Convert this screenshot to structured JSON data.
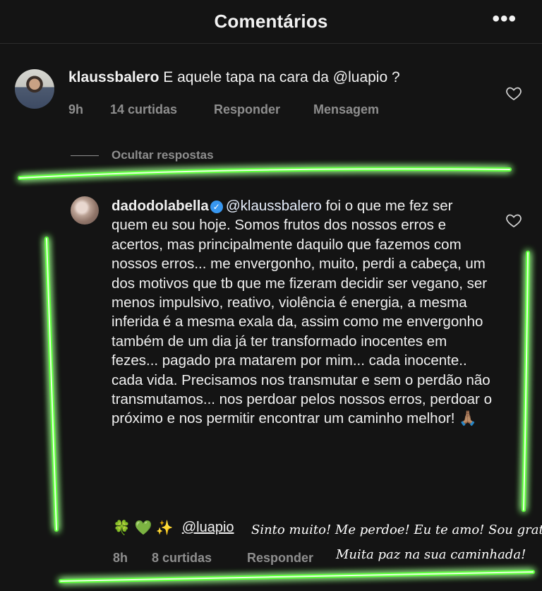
{
  "header": {
    "title": "Comentários",
    "more_icon": "more-horizontal-icon",
    "more_label": "•••"
  },
  "comment": {
    "username": "klaussbalero",
    "text": "E aquele tapa na cara da",
    "mention": "@luapio",
    "text_end": " ?",
    "time": "9h",
    "likes": "14 curtidas",
    "reply": "Responder",
    "message": "Mensagem"
  },
  "hide_replies": "Ocultar respostas",
  "reply": {
    "username": "dadodolabella",
    "mention": "@klaussbalero",
    "text": "foi o que me fez ser quem eu sou hoje. Somos frutos dos nossos erros e acertos, mas principalmente daquilo que fazemos com nossos erros... me envergonho, muito, perdi a cabeça, um dos motivos que tb que me fizeram decidir ser vegano, ser menos impulsivo, reativo, violência é energia, a mesma inferida é a mesma exala da, assim como me envergonho também de um dia já ter transformado inocentes em fezes... pagado pra matarem por mim... cada inocente.. cada vida. Precisamos nos transmutar e sem o perdão não transmutamos... nos perdoar pelos nossos erros, perdoar o próximo e nos permitir encontrar um caminho melhor! 🙏🏽",
    "emojis": "🍀 💚 ✨",
    "mention2": "@luapio",
    "time": "8h",
    "likes": "8 curtidas",
    "reply_btn": "Responder"
  },
  "overlay": {
    "line1": "Sinto muito! Me perdoe! Eu te amo! Sou grato!",
    "line2": "Muita paz na sua caminhada!"
  },
  "colors": {
    "glow": "#5cff3a",
    "background": "#141414",
    "meta": "#8e8e8e"
  }
}
